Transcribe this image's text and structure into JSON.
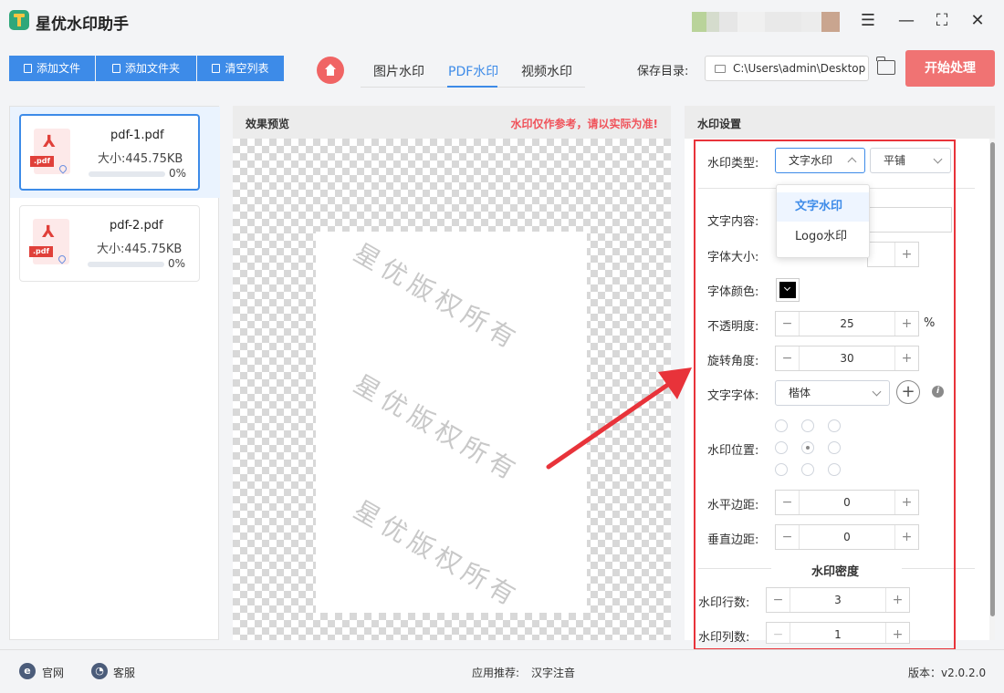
{
  "app": {
    "title": "星优水印助手"
  },
  "toolbar": {
    "add_file": "添加文件",
    "add_folder": "添加文件夹",
    "clear_list": "清空列表"
  },
  "tabs": [
    {
      "label": "图片水印",
      "active": false
    },
    {
      "label": "PDF水印",
      "active": true
    },
    {
      "label": "视频水印",
      "active": false
    }
  ],
  "save": {
    "label": "保存目录:",
    "path": "C:\\Users\\admin\\Desktop"
  },
  "start_button": "开始处理",
  "files": [
    {
      "name": "pdf-1.pdf",
      "size": "大小:445.75KB",
      "progress": "0%",
      "progress_value": 0,
      "selected": true
    },
    {
      "name": "pdf-2.pdf",
      "size": "大小:445.75KB",
      "progress": "0%",
      "progress_value": 0,
      "selected": false
    }
  ],
  "preview": {
    "title": "效果预览",
    "note": "水印仅作参考，请以实际为准!",
    "watermark_text": "星优版权所有"
  },
  "settings": {
    "title": "水印设置",
    "type_label": "水印类型:",
    "type_value": "文字水印",
    "layout_value": "平铺",
    "type_options": [
      "文字水印",
      "Logo水印"
    ],
    "text_content_label": "文字内容:",
    "font_size_label": "字体大小:",
    "font_color_label": "字体颜色:",
    "font_color": "#000000",
    "opacity_label": "不透明度:",
    "opacity_value": "25",
    "opacity_unit": "%",
    "rotation_label": "旋转角度:",
    "rotation_value": "30",
    "font_family_label": "文字字体:",
    "font_family_value": "楷体",
    "position_label": "水印位置:",
    "h_margin_label": "水平边距:",
    "h_margin_value": "0",
    "v_margin_label": "垂直边距:",
    "v_margin_value": "0",
    "density_title": "水印密度",
    "rows_label": "水印行数:",
    "rows_value": "3",
    "cols_label": "水印列数:",
    "cols_value": "1"
  },
  "footer": {
    "website": "官网",
    "support": "客服",
    "recommend_label": "应用推荐:",
    "recommend_app": "汉字注音",
    "version": "版本：v2.0.2.0"
  },
  "colors": {
    "accent": "#3d8be8",
    "start_button": "#f07373",
    "highlight_frame": "#e8333a",
    "preview_note": "#f0525a"
  }
}
